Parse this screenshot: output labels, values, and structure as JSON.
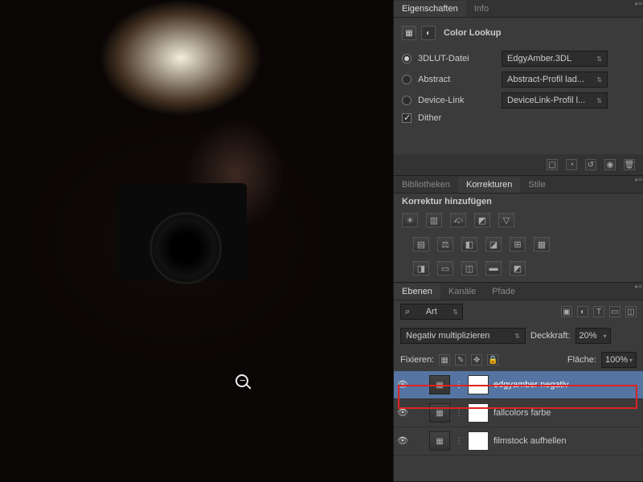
{
  "properties": {
    "tab1": "Eigenschaften",
    "tab2": "Info",
    "title": "Color Lookup",
    "rows": {
      "lut3d": {
        "label": "3DLUT-Datei",
        "value": "EdgyAmber.3DL"
      },
      "abstract": {
        "label": "Abstract",
        "value": "Abstract-Profil lad..."
      },
      "devicelink": {
        "label": "Device-Link",
        "value": "DeviceLink-Profil l..."
      },
      "dither": {
        "label": "Dither"
      }
    }
  },
  "libraries": {
    "tab1": "Bibliotheken",
    "tab2": "Korrekturen",
    "tab3": "Stile",
    "subtitle": "Korrektur hinzufügen"
  },
  "layers": {
    "tab1": "Ebenen",
    "tab2": "Kanäle",
    "tab3": "Pfade",
    "filter_label": "Art",
    "blend_mode": "Negativ multiplizieren",
    "opacity_label": "Deckkraft:",
    "opacity_value": "20%",
    "lock_label": "Fixieren:",
    "fill_label": "Fläche:",
    "fill_value": "100%",
    "items": [
      {
        "name": "edgyamber negativ",
        "selected": true
      },
      {
        "name": "fallcolors farbe",
        "selected": false
      },
      {
        "name": "filmstock aufhellen",
        "selected": false
      }
    ]
  },
  "icons": {
    "search": "⌕"
  }
}
